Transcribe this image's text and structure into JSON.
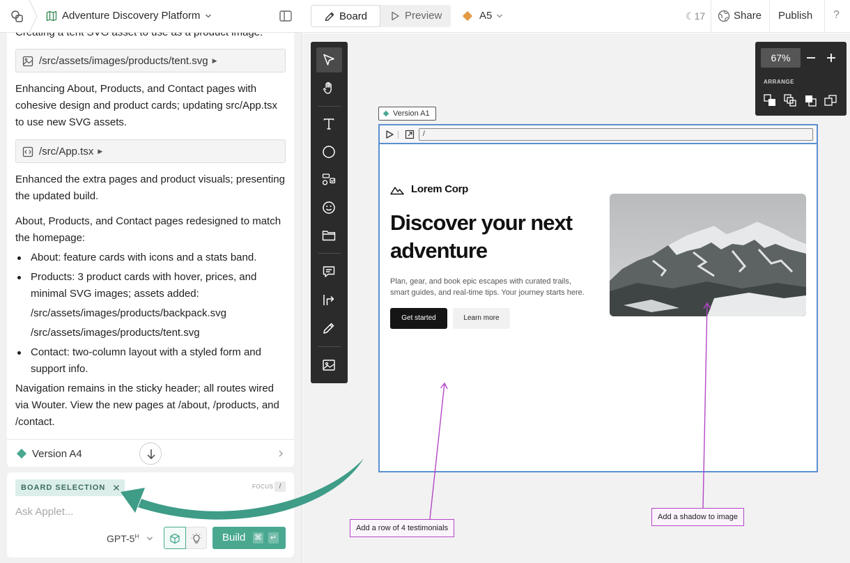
{
  "project": {
    "name": "Adventure Discovery Platform"
  },
  "chat": {
    "messages": [
      "Creating a tent SVG asset to use as a product image.",
      "Enhancing About, Products, and Contact pages with cohesive design and product cards; updating src/App.tsx to use new SVG assets.",
      "Enhanced the extra pages and product visuals; presenting the updated build.",
      "About, Products, and Contact pages redesigned to match the homepage:",
      "Navigation remains in the sticky header; all routes wired via Wouter. View the new pages at /about, /products, and /contact."
    ],
    "files": [
      "/src/assets/images/products/tent.svg",
      "/src/App.tsx"
    ],
    "bullets": [
      "About: feature cards with icons and a stats band.",
      "Products: 3 product cards with hover, prices, and minimal SVG images; assets added:",
      "/src/assets/images/products/backpack.svg",
      "/src/assets/images/products/tent.svg",
      "Contact: two-column layout with a styled form and support info."
    ],
    "version_label": "Version A4"
  },
  "composer": {
    "chip": "BOARD SELECTION",
    "focus_label": "FOCUS",
    "focus_key": "/",
    "placeholder": "Ask Applet...",
    "model": "GPT-5",
    "model_sup": "H",
    "build_label": "Build",
    "key_cmd": "⌘",
    "key_enter": "↵"
  },
  "topbar": {
    "tabs": [
      "Board",
      "Preview"
    ],
    "version": "A5",
    "credits": "17",
    "share": "Share",
    "publish": "Publish",
    "help": "?"
  },
  "zoom": {
    "value": "67%",
    "arrange_label": "ARRANGE"
  },
  "frame": {
    "tag": "Version A1",
    "url": "/",
    "site": {
      "brand": "Lorem Corp",
      "title": "Discover your next adventure",
      "subtitle": "Plan, gear, and book epic escapes with curated trails, smart guides, and real-time tips. Your journey starts here.",
      "primary_cta": "Get started",
      "secondary_cta": "Learn more"
    }
  },
  "notes": [
    "Add a row of 4 testimonials",
    "Add a shadow to image"
  ],
  "colors": {
    "accent": "#4aa891",
    "version_a5": "#e29a45",
    "frame_border": "#5b8fd0",
    "annotation": "#b347c6"
  }
}
